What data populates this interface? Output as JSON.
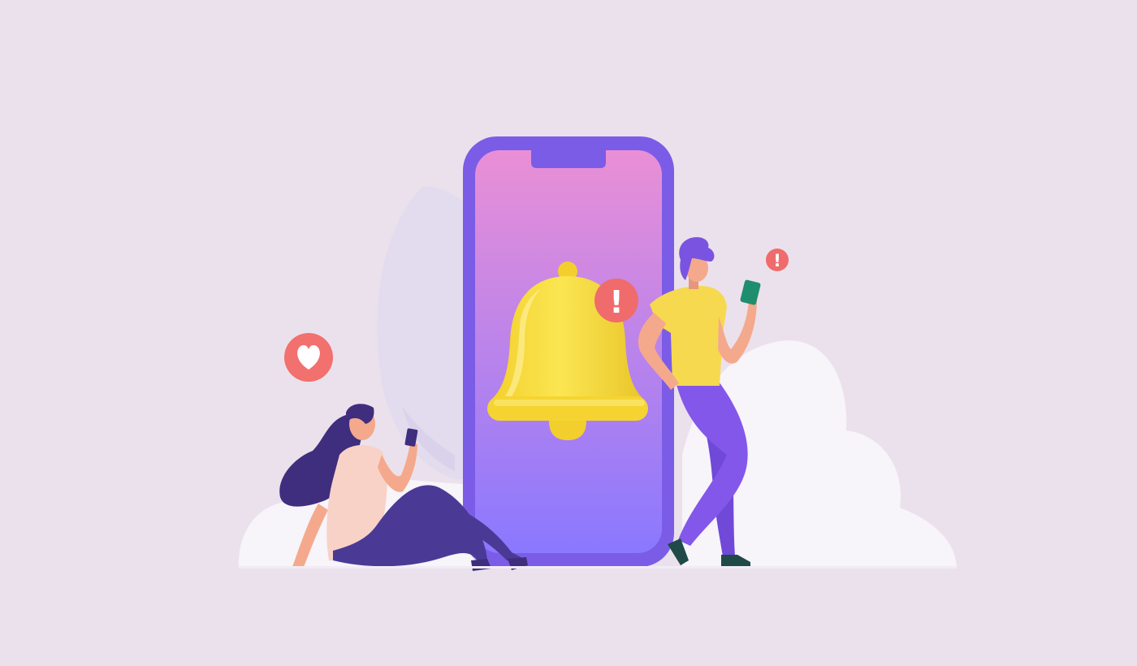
{
  "scene": {
    "subject": "notification-bell-illustration",
    "icons": [
      "bell-icon",
      "exclamation-icon",
      "heart-icon",
      "smartphone-icon"
    ],
    "marks": {
      "bell_alert": "!",
      "floating_alert": "!"
    }
  },
  "colors": {
    "background": "#ebe1ec",
    "cloud": "#f7f4fa",
    "leaf": "#e2dcee",
    "phone_frame": "#7b5ce6",
    "screen_top": "#ea8fd6",
    "screen_bottom": "#8a78ff",
    "bell": "#f7dc3f",
    "bell_shade": "#e6c22a",
    "alert_badge": "#f06b6b",
    "heart_badge": "#f2706e",
    "man_shirt": "#f6d94f",
    "man_pants": "#8357ea",
    "man_hair": "#7a54e0",
    "woman_top": "#f8d2c7",
    "woman_hair": "#3f2d7e",
    "woman_pants": "#4b3a95",
    "skin": "#f4a98d",
    "man_phone": "#1e8e6e"
  }
}
